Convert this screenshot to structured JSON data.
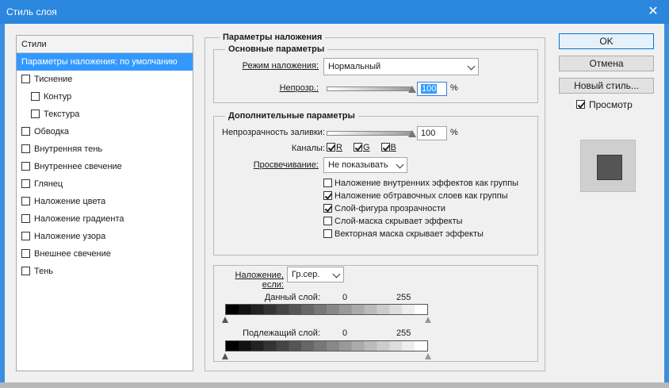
{
  "window": {
    "title": "Стиль слоя",
    "close_icon": "close-icon"
  },
  "styles": {
    "header": "Стили",
    "items": [
      {
        "label": "Параметры наложения: по умолчанию",
        "checkbox": false,
        "selected": true
      },
      {
        "label": "Тиснение",
        "checkbox": true,
        "checked": false
      },
      {
        "label": "Контур",
        "checkbox": true,
        "checked": false,
        "sub": true
      },
      {
        "label": "Текстура",
        "checkbox": true,
        "checked": false,
        "sub": true
      },
      {
        "label": "Обводка",
        "checkbox": true,
        "checked": false
      },
      {
        "label": "Внутренняя тень",
        "checkbox": true,
        "checked": false
      },
      {
        "label": "Внутреннее свечение",
        "checkbox": true,
        "checked": false
      },
      {
        "label": "Глянец",
        "checkbox": true,
        "checked": false
      },
      {
        "label": "Наложение цвета",
        "checkbox": true,
        "checked": false
      },
      {
        "label": "Наложение градиента",
        "checkbox": true,
        "checked": false
      },
      {
        "label": "Наложение узора",
        "checkbox": true,
        "checked": false
      },
      {
        "label": "Внешнее свечение",
        "checkbox": true,
        "checked": false
      },
      {
        "label": "Тень",
        "checkbox": true,
        "checked": false
      }
    ]
  },
  "blend": {
    "title": "Параметры наложения",
    "general": {
      "title": "Основные параметры",
      "mode_label": "Режим наложения:",
      "mode_value": "Нормальный",
      "opacity_label": "Непрозр.:",
      "opacity_value": "100",
      "opacity_level": 1.0,
      "pct": "%"
    },
    "advanced": {
      "title": "Дополнительные параметры",
      "fill_label": "Непрозрачность заливки:",
      "fill_value": "100",
      "fill_level": 1.0,
      "pct": "%",
      "channels_label": "Каналы:",
      "channels": [
        {
          "label": "R",
          "checked": true
        },
        {
          "label": "G",
          "checked": true
        },
        {
          "label": "B",
          "checked": true
        }
      ],
      "knockout_label": "Просвечивание:",
      "knockout_value": "Не показывать",
      "options": [
        {
          "label": "Наложение внутренних эффектов как группы",
          "checked": false
        },
        {
          "label": "Наложение обтравочных слоев как группы",
          "checked": true
        },
        {
          "label": "Слой-фигура прозрачности",
          "checked": true
        },
        {
          "label": "Слой-маска скрывает эффекты",
          "checked": false
        },
        {
          "label": "Векторная маска скрывает эффекты",
          "checked": false
        }
      ]
    },
    "blend_if": {
      "label": "Наложение, если:",
      "value": "Гр.сер.",
      "this_layer_label": "Данный слой:",
      "this_layer_min": "0",
      "this_layer_max": "255",
      "underlying_label": "Подлежащий слой:",
      "underlying_min": "0",
      "underlying_max": "255"
    }
  },
  "buttons": {
    "ok": "OK",
    "cancel": "Отмена",
    "new_style": "Новый стиль...",
    "preview_label": "Просмотр",
    "preview_checked": true
  },
  "colors": {
    "titlebar": "#2b87dd",
    "selection": "#3399ff",
    "preview_swatch": "#555555"
  }
}
